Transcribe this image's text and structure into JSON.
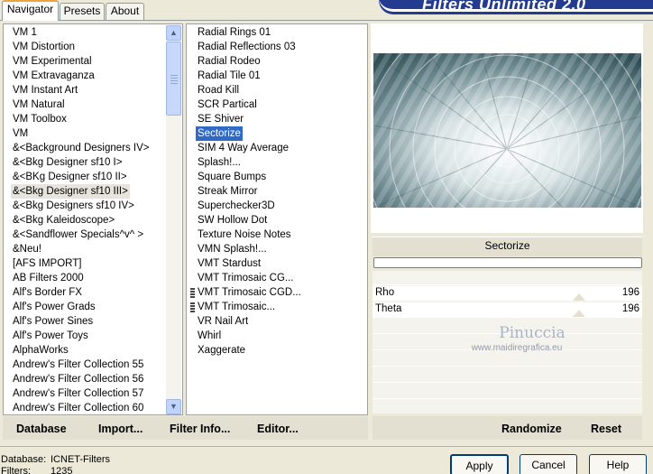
{
  "banner": {
    "title": "Filters Unlimited 2.0"
  },
  "tabs": [
    {
      "label": "Navigator",
      "active": true
    },
    {
      "label": "Presets",
      "active": false
    },
    {
      "label": "About",
      "active": false
    }
  ],
  "categories": [
    "VM 1",
    "VM Distortion",
    "VM Experimental",
    "VM Extravaganza",
    "VM Instant Art",
    "VM Natural",
    "VM Toolbox",
    "VM",
    "&<Background Designers IV>",
    "&<Bkg Designer sf10 I>",
    "&<BKg Designer sf10 II>",
    "&<Bkg Designer sf10 III>",
    "&<Bkg Designers sf10 IV>",
    "&<Bkg Kaleidoscope>",
    "&<Sandflower Specials^v^ >",
    "&Neu!",
    "[AFS IMPORT]",
    "AB Filters 2000",
    "Alf's Border FX",
    "Alf's Power Grads",
    "Alf's Power Sines",
    "Alf's Power Toys",
    "AlphaWorks",
    "Andrew's Filter Collection 55",
    "Andrew's Filter Collection 56",
    "Andrew's Filter Collection 57",
    "Andrew's Filter Collection 60"
  ],
  "selected_category_index": 11,
  "filters": [
    "Radial  Rings 01",
    "Radial Reflections 03",
    "Radial Rodeo",
    "Radial Tile 01",
    "Road Kill",
    "SCR  Partical",
    "SE Shiver",
    "Sectorize",
    "SIM 4 Way Average",
    "Splash!...",
    "Square Bumps",
    "Streak Mirror",
    "Superchecker3D",
    "SW Hollow Dot",
    "Texture Noise Notes",
    "VMN Splash!...",
    "VMT Stardust",
    "VMT Trimosaic CG...",
    "VMT Trimosaic CGD...",
    "VMT Trimosaic...",
    "VR Nail Art",
    "Whirl",
    "Xaggerate"
  ],
  "selected_filter_index": 7,
  "filter_name": "Sectorize",
  "params": [
    {
      "name": "Rho",
      "value": "196"
    },
    {
      "name": "Theta",
      "value": "196"
    }
  ],
  "watermark": {
    "line1": "Pinuccia",
    "line2": "www.maidiregrafica.eu"
  },
  "commands": {
    "database": "Database",
    "import": "Import...",
    "filter_info": "Filter Info...",
    "editor": "Editor...",
    "randomize": "Randomize",
    "reset": "Reset"
  },
  "status": {
    "database_label": "Database:",
    "database_value": "ICNET-Filters",
    "filters_label": "Filters:",
    "filters_value": "1235"
  },
  "buttons": {
    "apply": "Apply",
    "cancel": "Cancel",
    "help": "Help"
  },
  "colors": {
    "selection": "#316ac5",
    "banner": "#233c8f",
    "window_bg": "#ece9d8"
  },
  "icons": {
    "scroll_up": "▲",
    "scroll_down": "▼"
  }
}
